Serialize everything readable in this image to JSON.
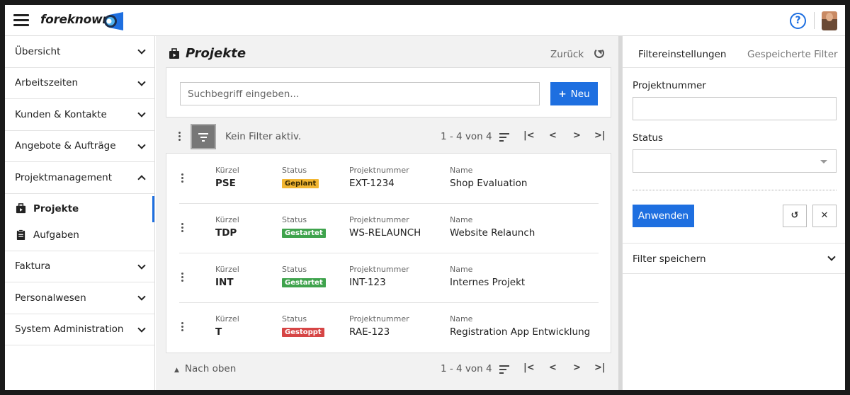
{
  "app": {
    "brand": "foreknown"
  },
  "header": {
    "help_icon": "help-icon",
    "help_glyph": "?"
  },
  "sidebar": {
    "items": [
      {
        "label": "Übersicht"
      },
      {
        "label": "Arbeitszeiten"
      },
      {
        "label": "Kunden & Kontakte"
      },
      {
        "label": "Angebote & Aufträge"
      },
      {
        "label": "Projektmanagement",
        "expanded": true
      },
      {
        "label": "Faktura"
      },
      {
        "label": "Personalwesen"
      },
      {
        "label": "System Administration"
      }
    ],
    "subitems": [
      {
        "label": "Projekte",
        "active": true,
        "icon": "briefcase-icon"
      },
      {
        "label": "Aufgaben",
        "icon": "clipboard-icon"
      }
    ]
  },
  "main": {
    "title": "Projekte",
    "back_label": "Zurück",
    "search_placeholder": "Suchbegriff eingeben...",
    "new_label": "Neu",
    "filter_status": "Kein Filter aktiv.",
    "pager_text": "1 - 4 von 4",
    "to_top_label": "Nach oben",
    "columns": {
      "short": "Kürzel",
      "status": "Status",
      "number": "Projektnummer",
      "name": "Name"
    },
    "rows": [
      {
        "short": "PSE",
        "status": "Geplant",
        "status_color": "#f2b632",
        "number": "EXT-1234",
        "name": "Shop Evaluation"
      },
      {
        "short": "TDP",
        "status": "Gestartet",
        "status_color": "#3fa34d",
        "number": "WS-RELAUNCH",
        "name": "Website Relaunch"
      },
      {
        "short": "INT",
        "status": "Gestartet",
        "status_color": "#3fa34d",
        "number": "INT-123",
        "name": "Internes Projekt"
      },
      {
        "short": "T",
        "status": "Gestoppt",
        "status_color": "#d64545",
        "number": "RAE-123",
        "name": "Registration App Entwicklung"
      }
    ]
  },
  "panel": {
    "tab_active": "Filtereinstellungen",
    "tab_inactive": "Gespeicherte Filter",
    "field_number_label": "Projektnummer",
    "field_status_label": "Status",
    "apply_label": "Anwenden",
    "save_filter_label": "Filter speichern"
  },
  "colors": {
    "accent": "#1e6fe0"
  }
}
